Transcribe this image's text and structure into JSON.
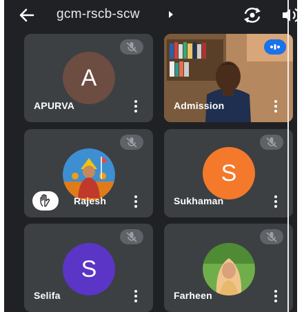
{
  "meeting": {
    "code": "gcm-rscb-scw"
  },
  "colors": {
    "background": "#202124",
    "tile": "#3c4043",
    "accent": "#1a73e8"
  },
  "icons": {
    "back": "arrow-left-icon",
    "caret": "caret-right-icon",
    "switch_camera": "switch-camera-icon",
    "audio": "speaker-icon",
    "muted": "mic-off-icon",
    "more": "more-vert-icon",
    "hand": "raised-hand-icon",
    "speaking": "speaking-indicator-icon"
  },
  "participants": [
    {
      "name": "APURVA",
      "avatar_letter": "A",
      "avatar_color": "#6d4c41",
      "muted": true
    },
    {
      "name": "Admission",
      "video": true,
      "speaking": true
    },
    {
      "name": "Rajesh",
      "avatar_photo": true,
      "muted": true,
      "hand_raised": true
    },
    {
      "name": "Sukhaman",
      "avatar_letter": "S",
      "avatar_color": "#f4792b",
      "muted": true
    },
    {
      "name": "Selifa",
      "avatar_letter": "S",
      "avatar_color": "#5b35c5",
      "muted": true
    },
    {
      "name": "Farheen",
      "avatar_photo": true,
      "muted": true
    }
  ]
}
